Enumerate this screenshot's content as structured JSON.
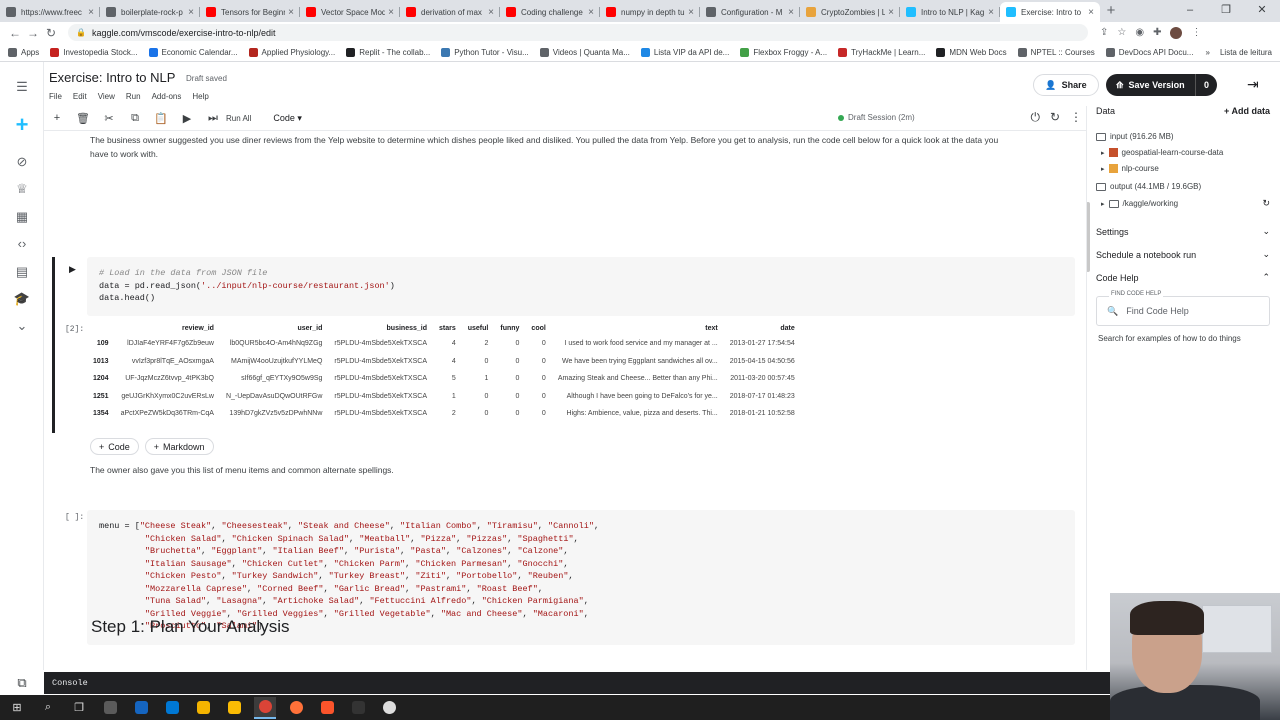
{
  "browser": {
    "tabs": [
      {
        "title": "https://www.freec",
        "color": "#5f6368"
      },
      {
        "title": "boilerplate-rock-p",
        "color": "#5f6368"
      },
      {
        "title": "Tensors for Beginn",
        "color": "#ff0000"
      },
      {
        "title": "Vector Space Mod",
        "color": "#ff0000"
      },
      {
        "title": "derivation of max",
        "color": "#ff0000"
      },
      {
        "title": "Coding challenge",
        "color": "#ff0000"
      },
      {
        "title": "numpy in depth tu",
        "color": "#ff0000"
      },
      {
        "title": "Configuration - M",
        "color": "#5f6368"
      },
      {
        "title": "CryptoZombies | L",
        "color": "#e8a33c"
      },
      {
        "title": "Intro to NLP | Kag",
        "color": "#20beff"
      },
      {
        "title": "Exercise: Intro to",
        "color": "#20beff"
      }
    ],
    "new_tab_label": "+",
    "url": "kaggle.com/vmscode/exercise-intro-to-nlp/edit",
    "bookmarks": [
      {
        "label": "Apps",
        "color": "#5f6368"
      },
      {
        "label": "Investopedia Stock...",
        "color": "#c5221f"
      },
      {
        "label": "Economic Calendar...",
        "color": "#1a73e8"
      },
      {
        "label": "Applied Physiology...",
        "color": "#b3261e"
      },
      {
        "label": "Replit - The collab...",
        "color": "#202124"
      },
      {
        "label": "Python Tutor - Visu...",
        "color": "#3b78b1"
      },
      {
        "label": "Videos | Quanta Ma...",
        "color": "#5f6368"
      },
      {
        "label": "Lista VIP da API de...",
        "color": "#1e88e5"
      },
      {
        "label": "Flexbox Froggy - A...",
        "color": "#43a047"
      },
      {
        "label": "TryHackMe | Learn...",
        "color": "#c62828"
      },
      {
        "label": "MDN Web Docs",
        "color": "#202124"
      },
      {
        "label": "NPTEL :: Courses",
        "color": "#5f6368"
      },
      {
        "label": "DevDocs API Docu...",
        "color": "#5f6368"
      }
    ],
    "bookmarks_more": "»",
    "reading_list": "Lista de leitura"
  },
  "header": {
    "title": "Exercise: Intro to NLP",
    "draft_saved": "Draft saved",
    "menu": [
      "File",
      "Edit",
      "View",
      "Run",
      "Add-ons",
      "Help"
    ],
    "share_label": "Share",
    "save_label": "Save Version",
    "save_count": "0"
  },
  "toolbar": {
    "run_all_label": "Run All",
    "cell_type": "Code",
    "session_status": "Draft Session (2m)"
  },
  "notebook": {
    "intro_text": "The business owner suggested you use diner reviews from the Yelp website to determine which dishes people liked and disliked. You pulled the data from Yelp. Before you get to analysis, run the code cell below for a quick look at the data you have to work with.",
    "cell1": {
      "comment": "# Load in the data from JSON file",
      "line2_a": "data = pd.read_json(",
      "line2_str": "'../input/nlp-course/restaurant.json'",
      "line2_b": ")",
      "line3": "data.head()",
      "prompt": "[2]:"
    },
    "table": {
      "columns": [
        "",
        "review_id",
        "user_id",
        "business_id",
        "stars",
        "useful",
        "funny",
        "cool",
        "text",
        "date"
      ],
      "rows": [
        [
          "109",
          "lDJIaF4eYRF4F7g6Zb9euw",
          "lb0QUR5bc4O-Am4hNq9ZGg",
          "r5PLDU-4mSbde5XekTXSCA",
          "4",
          "2",
          "0",
          "0",
          "I used to work food service and my manager at ...",
          "2013-01-27 17:54:54"
        ],
        [
          "1013",
          "vvIzf3pr8lTqE_AOsxmgaA",
          "MAmijW4ooUzujtkufYYLMeQ",
          "r5PLDU-4mSbde5XekTXSCA",
          "4",
          "0",
          "0",
          "0",
          "We have been trying Eggplant sandwiches all ov...",
          "2015-04-15 04:50:56"
        ],
        [
          "1204",
          "UF-JqzMczZ6tvvp_4tPK3bQ",
          "sIf66gf_qEYTXy9O5w9Sg",
          "r5PLDU-4mSbde5XekTXSCA",
          "5",
          "1",
          "0",
          "0",
          "Amazing Steak and Cheese... Better than any Phi...",
          "2011-03-20 00:57:45"
        ],
        [
          "1251",
          "geUJGrKhXymx0C2uvERsLw",
          "N_-UepDavAsuDQwOUtRFGw",
          "r5PLDU-4mSbde5XekTXSCA",
          "1",
          "0",
          "0",
          "0",
          "Although I have been going to DeFalco's for ye...",
          "2018-07-17 01:48:23"
        ],
        [
          "1354",
          "aPctXPeZW5kDq36TRm-CqA",
          "139hD7gkZVz5v5zDPwhNNw",
          "r5PLDU-4mSbde5XekTXSCA",
          "2",
          "0",
          "0",
          "0",
          "Highs: Ambience, value, pizza and deserts. Thi...",
          "2018-01-21 10:52:58"
        ]
      ]
    },
    "add_code_label": "Code",
    "add_markdown_label": "Markdown",
    "menu_text": "The owner also gave you this list of menu items and common alternate spellings.",
    "cell2_prompt": "[ ]:",
    "menu_items": [
      "Cheese Steak",
      "Cheesesteak",
      "Steak and Cheese",
      "Italian Combo",
      "Tiramisu",
      "Cannoli",
      "Chicken Salad",
      "Chicken Spinach Salad",
      "Meatball",
      "Pizza",
      "Pizzas",
      "Spaghetti",
      "Bruchetta",
      "Eggplant",
      "Italian Beef",
      "Purista",
      "Pasta",
      "Calzones",
      "Calzone",
      "Italian Sausage",
      "Chicken Cutlet",
      "Chicken Parm",
      "Chicken Parmesan",
      "Gnocchi",
      "Chicken Pesto",
      "Turkey Sandwich",
      "Turkey Breast",
      "Ziti",
      "Portobello",
      "Reuben",
      "Mozzarella Caprese",
      "Corned Beef",
      "Garlic Bread",
      "Pastrami",
      "Roast Beef",
      "Tuna Salad",
      "Lasagna",
      "Artichoke Salad",
      "Fettuccini Alfredo",
      "Chicken Parmigiana",
      "Grilled Veggie",
      "Grilled Veggies",
      "Grilled Vegetable",
      "Mac and Cheese",
      "Macaroni",
      "Prosciutto",
      "Salami"
    ],
    "step_heading": "Step 1: Plan Your Analysis"
  },
  "right_panel": {
    "data_title": "Data",
    "add_data_label": "Add data",
    "input_label": "input (916.26 MB)",
    "input_items": [
      "geospatial-learn-course-data",
      "nlp-course"
    ],
    "output_label": "output (44.1MB / 19.6GB)",
    "output_items": [
      "/kaggle/working"
    ],
    "settings_label": "Settings",
    "schedule_label": "Schedule a notebook run",
    "code_help_label": "Code Help",
    "find_code_help_label": "FIND CODE HELP",
    "find_code_help_placeholder": "Find Code Help",
    "search_examples_text": "Search for examples of how to do things"
  },
  "console": {
    "label": "Console"
  },
  "colors": {
    "accent": "#20beff",
    "dark": "#202124",
    "session_green": "#34a853"
  }
}
